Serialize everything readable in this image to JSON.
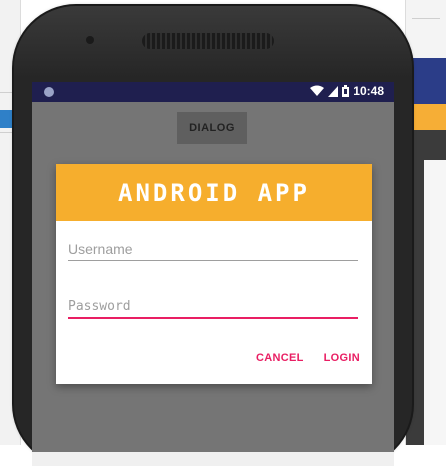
{
  "status_bar": {
    "time": "10:48"
  },
  "main": {
    "dialog_button_label": "DIALOG"
  },
  "dialog": {
    "title": "ANDROID APP",
    "username_placeholder": "Username",
    "password_placeholder": "Password",
    "cancel_label": "CANCEL",
    "login_label": "LOGIN"
  },
  "colors": {
    "header": "#f6ae2d",
    "accent": "#e91e63",
    "status_bar": "#1f1f4f",
    "dim_background": "#757575"
  }
}
